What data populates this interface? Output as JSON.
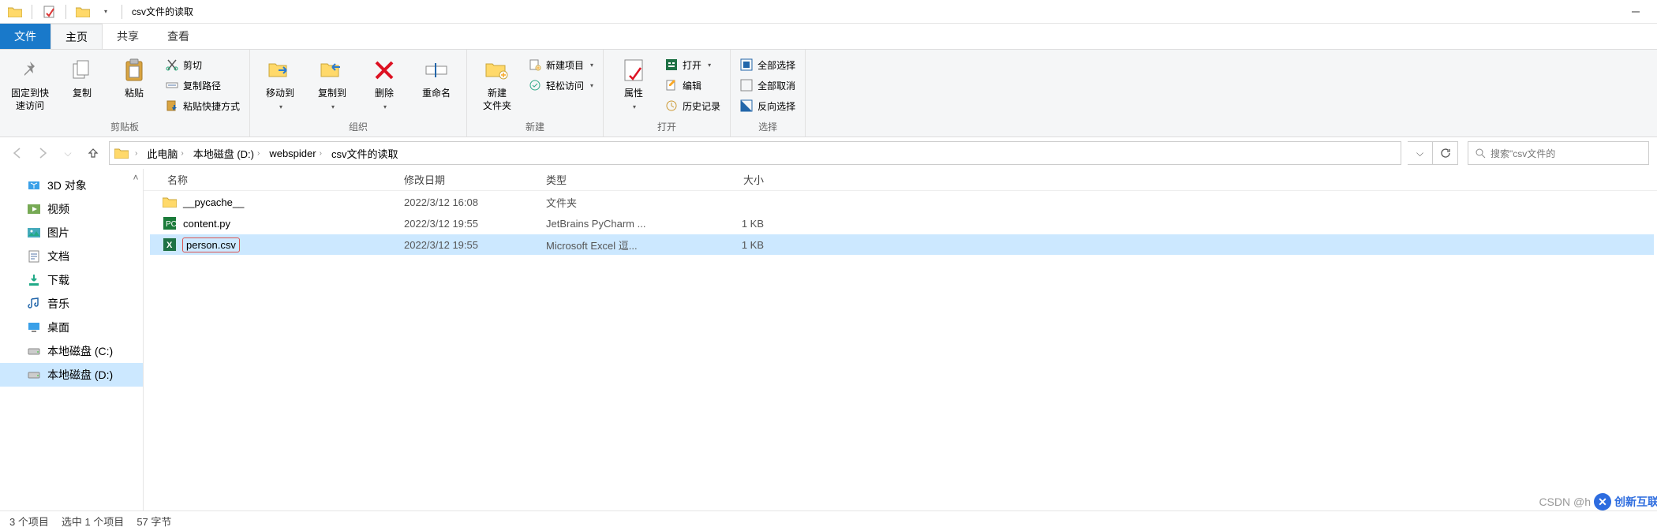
{
  "title": "csv文件的读取",
  "qat_dropdown": "▾",
  "tabs": {
    "file": "文件",
    "home": "主页",
    "share": "共享",
    "view": "查看"
  },
  "ribbon": {
    "clipboard": {
      "pin": "固定到快\n速访问",
      "copy": "复制",
      "paste": "粘贴",
      "cut": "剪切",
      "copypath": "复制路径",
      "pasteshortcut": "粘贴快捷方式",
      "label": "剪贴板"
    },
    "organize": {
      "moveto": "移动到",
      "copyto": "复制到",
      "delete": "删除",
      "rename": "重命名",
      "label": "组织"
    },
    "new": {
      "newfolder": "新建\n文件夹",
      "newitem": "新建项目",
      "easyaccess": "轻松访问",
      "label": "新建"
    },
    "open": {
      "properties": "属性",
      "open": "打开",
      "edit": "编辑",
      "history": "历史记录",
      "label": "打开"
    },
    "select": {
      "selectall": "全部选择",
      "selectnone": "全部取消",
      "invert": "反向选择",
      "label": "选择"
    }
  },
  "breadcrumbs": [
    "此电脑",
    "本地磁盘 (D:)",
    "webspider",
    "csv文件的读取"
  ],
  "search_placeholder": "搜索\"csv文件的",
  "navpane": [
    {
      "icon": "3d",
      "label": "3D 对象"
    },
    {
      "icon": "video",
      "label": "视频"
    },
    {
      "icon": "pictures",
      "label": "图片"
    },
    {
      "icon": "docs",
      "label": "文档"
    },
    {
      "icon": "downloads",
      "label": "下载"
    },
    {
      "icon": "music",
      "label": "音乐"
    },
    {
      "icon": "desktop",
      "label": "桌面"
    },
    {
      "icon": "drive",
      "label": "本地磁盘 (C:)"
    },
    {
      "icon": "drive",
      "label": "本地磁盘 (D:)",
      "selected": true
    }
  ],
  "columns": {
    "name": "名称",
    "date": "修改日期",
    "type": "类型",
    "size": "大小"
  },
  "files": [
    {
      "icon": "folder",
      "name": "__pycache__",
      "date": "2022/3/12 16:08",
      "type": "文件夹",
      "size": "",
      "selected": false,
      "highlighted": false
    },
    {
      "icon": "pycharm",
      "name": "content.py",
      "date": "2022/3/12 19:55",
      "type": "JetBrains PyCharm ...",
      "size": "1 KB",
      "selected": false,
      "highlighted": false
    },
    {
      "icon": "excel",
      "name": "person.csv",
      "date": "2022/3/12 19:55",
      "type": "Microsoft Excel 逗...",
      "size": "1 KB",
      "selected": true,
      "highlighted": true
    }
  ],
  "statusbar": {
    "items": "3 个项目",
    "selected": "选中 1 个项目",
    "bytes": "57 字节"
  },
  "watermark": {
    "prefix": "CSDN @h",
    "brand": "创新互联"
  }
}
